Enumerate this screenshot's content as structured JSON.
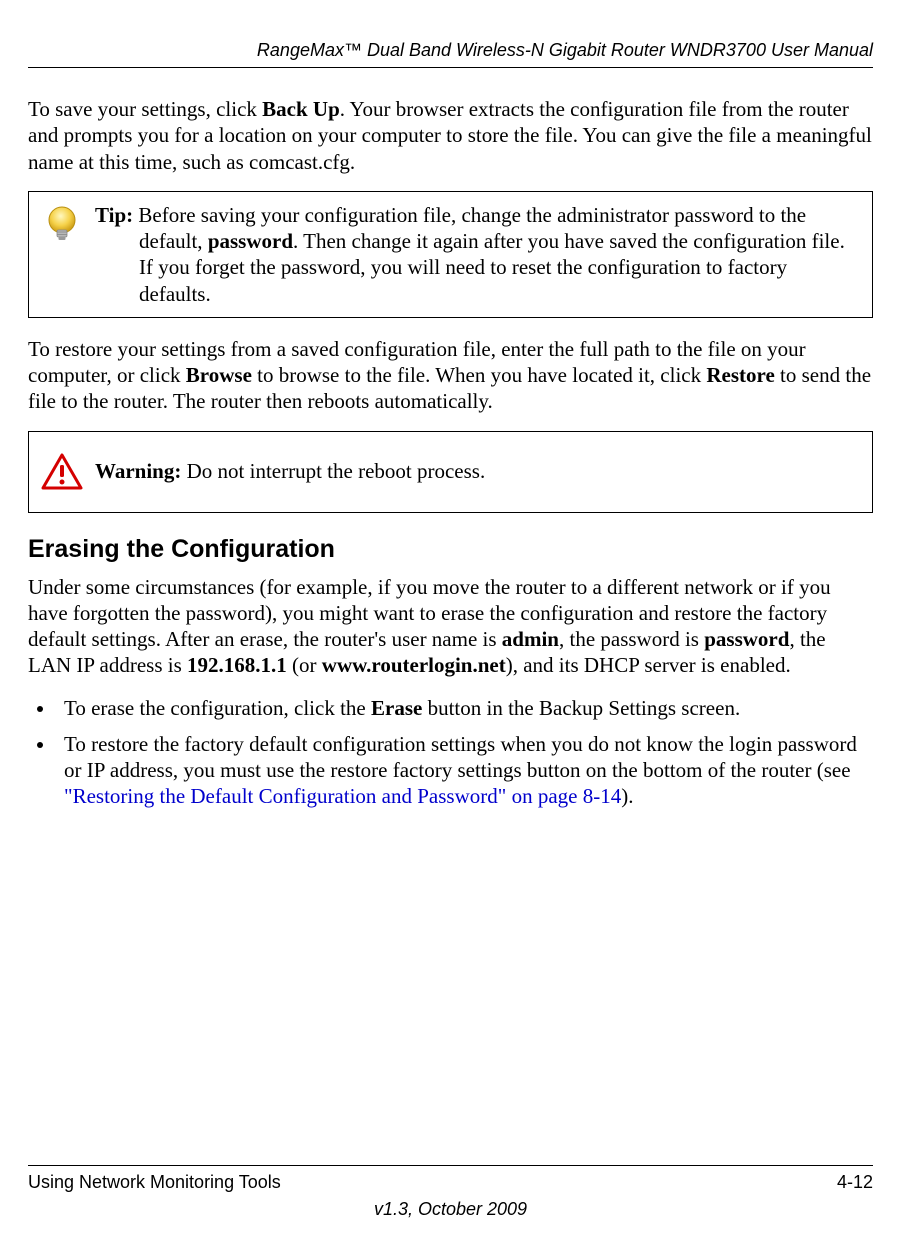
{
  "header": {
    "title": "RangeMax™ Dual Band Wireless-N Gigabit Router WNDR3700 User Manual"
  },
  "para1": {
    "pre": "To save your settings, click ",
    "bold1": "Back Up",
    "post": ". Your browser extracts the configuration file from the router and prompts you for a location on your computer to store the file. You can give the file a meaningful name at this time, such as comcast.cfg."
  },
  "tip": {
    "label": "Tip:",
    "pre": " Before saving your configuration file, change the administrator password to the default, ",
    "bold1": "password",
    "post": ". Then change it again after you have saved the configuration file. If you forget the password, you will need to reset the configuration to factory defaults."
  },
  "para2": {
    "pre": "To restore your settings from a saved configuration file, enter the full path to the file on your computer, or click ",
    "bold1": "Browse",
    "mid": " to browse to the file. When you have located it, click ",
    "bold2": "Restore",
    "post": " to send the file to the router. The router then reboots automatically."
  },
  "warning": {
    "label": "Warning:",
    "text": " Do not interrupt the reboot process."
  },
  "section": {
    "heading": "Erasing the Configuration"
  },
  "para3": {
    "pre": "Under some circumstances (for example, if you move the router to a different network or if you have forgotten the password), you might want to erase the configuration and restore the factory default settings. After an erase, the router's user name is ",
    "bold1": "admin",
    "mid1": ", the password is ",
    "bold2": "password",
    "mid2": ", the LAN IP address is ",
    "bold3": "192.168.1.1",
    "mid3": " (or ",
    "bold4": "www.routerlogin.net",
    "post": "), and its DHCP server is enabled."
  },
  "bullets": [
    {
      "pre": "To erase the configuration, click the ",
      "bold1": "Erase",
      "post": " button in the Backup Settings screen."
    },
    {
      "pre": "To restore the factory default configuration settings when you do not know the login password or IP address, you must use the restore factory settings button on the bottom of the router (see ",
      "link": "\"Restoring the Default Configuration and Password\" on page 8-14",
      "post": ")."
    }
  ],
  "footer": {
    "left": "Using Network Monitoring Tools",
    "right": "4-12",
    "version": "v1.3, October 2009"
  }
}
